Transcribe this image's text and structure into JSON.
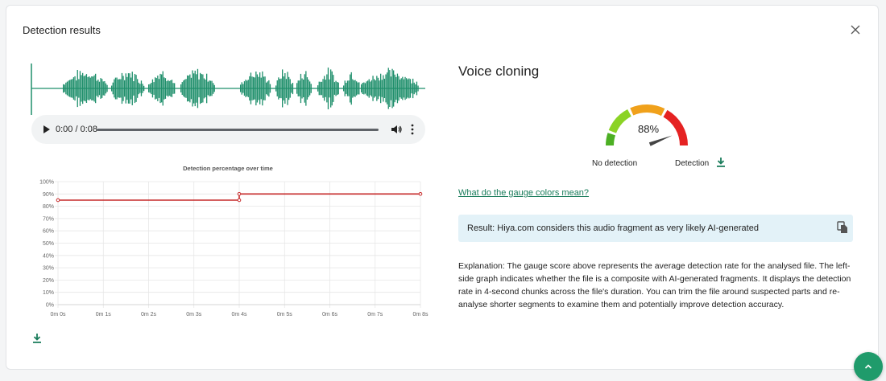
{
  "header": {
    "title": "Detection results"
  },
  "player": {
    "time": "0:00 / 0:08"
  },
  "chart_data": {
    "type": "line",
    "title": "Detection percentage over time",
    "x_tick_labels": [
      "0m 0s",
      "0m 1s",
      "0m 2s",
      "0m 3s",
      "0m 4s",
      "0m 5s",
      "0m 6s",
      "0m 7s",
      "0m 8s"
    ],
    "y_tick_labels": [
      "0%",
      "10%",
      "20%",
      "30%",
      "40%",
      "50%",
      "60%",
      "70%",
      "80%",
      "90%",
      "100%"
    ],
    "x_unit": "seconds",
    "xlim": [
      0,
      8
    ],
    "ylim": [
      0,
      100
    ],
    "grid": true,
    "series": [
      {
        "x": [
          0,
          4,
          4,
          8
        ],
        "y": [
          85,
          85,
          90,
          90
        ],
        "color": "#c62828",
        "step": true
      }
    ]
  },
  "result_panel": {
    "heading": "Voice cloning",
    "gauge": {
      "value": 88,
      "value_label": "88%",
      "colors": [
        "#4caf23",
        "#8bd325",
        "#f0a11b",
        "#e52222"
      ],
      "label_low": "No detection",
      "label_high": "Detection"
    },
    "gauge_link": "What do the gauge colors mean?",
    "result_text": "Result: Hiya.com considers this audio fragment as very likely AI-generated",
    "explanation": "Explanation: The gauge score above represents the average detection rate for the analysed file. The left-side graph indicates whether the file is a composite with AI-generated fragments. It displays the detection rate in 4-second chunks across the file's duration. You can trim the file around suspected parts and re-analyse shorter segments to examine them and potentially improve detection accuracy."
  },
  "colors": {
    "accent": "#1a7c5b",
    "waveform": "#1f8f6b",
    "result_bg": "#e3f2f8",
    "fab": "#1f9b6b"
  }
}
